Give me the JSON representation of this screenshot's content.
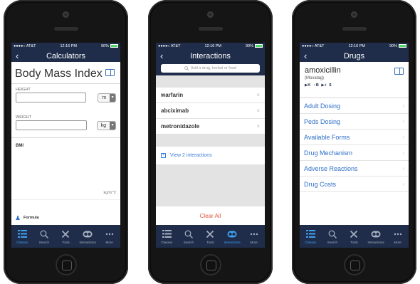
{
  "status": {
    "carrier": "●●●●○ AT&T",
    "time": "12:16 PM",
    "battery": "90%"
  },
  "tabs": [
    {
      "label": "Classes",
      "icon": "list-icon"
    },
    {
      "label": "Search",
      "icon": "search-icon"
    },
    {
      "label": "Tools",
      "icon": "tools-icon"
    },
    {
      "label": "Interactions",
      "icon": "interactions-icon"
    },
    {
      "label": "More",
      "icon": "more-icon"
    }
  ],
  "calculators": {
    "nav_title": "Calculators",
    "title": "Body Mass Index",
    "height_label": "HEIGHT",
    "height_unit": "m",
    "weight_label": "WEIGHT",
    "weight_unit": "kg",
    "result_label": "BMI",
    "result_unit": "kg/m^2",
    "formula_label": "Formula"
  },
  "interactions": {
    "nav_title": "Interactions",
    "search_placeholder": "Add a drug, herbal or food",
    "drugs": [
      "warfarin",
      "abciximab",
      "metronidazole"
    ],
    "remove_symbol": "×",
    "view_label": "View 2 interactions",
    "clear_label": "Clear All"
  },
  "drugs": {
    "nav_title": "Drugs",
    "drug_name": "amoxicillin",
    "brand_name": "(Moxatag)",
    "badges": "▶K ♀B ▶+ $",
    "menu": [
      "Adult Dosing",
      "Peds Dosing",
      "Available Forms",
      "Drug Mechanism",
      "Adverse Reactions",
      "Drug Costs"
    ]
  },
  "colors": {
    "nav": "#1f2d4a",
    "accent": "#3a7fd6",
    "active_tab": "#3fa0f0",
    "clear": "#e05a3a"
  }
}
